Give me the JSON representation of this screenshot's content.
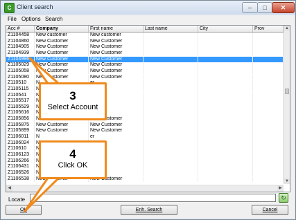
{
  "window": {
    "title": "Client search",
    "app_icon_glyph": "C",
    "minimize_glyph": "–",
    "maximize_glyph": "□",
    "close_glyph": "✕"
  },
  "menu": [
    "File",
    "Options",
    "Search"
  ],
  "columns": [
    "Acc #",
    "Company",
    "First name",
    "Last name",
    "City",
    "Prov"
  ],
  "rows": [
    [
      "Z1104458",
      "New customer",
      "New customer"
    ],
    [
      "Z1104860",
      "New Customer",
      "New Customer"
    ],
    [
      "Z1104905",
      "New Customer",
      "New Customer"
    ],
    [
      "Z1104939",
      "New Customer",
      "New Customer"
    ],
    [
      "Z1104996",
      "New Customer",
      "New Customer"
    ],
    [
      "Z1105029",
      "New Customer",
      "New Customer"
    ],
    [
      "Z1105058",
      "New Customer",
      "New Customer"
    ],
    [
      "Z1105080",
      "New Customer",
      "New Customer"
    ],
    [
      "Z110510",
      "N",
      "er"
    ],
    [
      "Z1105115",
      "N",
      "er"
    ],
    [
      "Z110541",
      "N",
      "er"
    ],
    [
      "Z1105517",
      "N",
      "er"
    ],
    [
      "Z1105529",
      "N",
      "er"
    ],
    [
      "Z1105616",
      "N",
      "er"
    ],
    [
      "Z1105856",
      "New Customer",
      "New Customer"
    ],
    [
      "Z1105875",
      "New Customer",
      "New Customer"
    ],
    [
      "Z1105899",
      "New Customer",
      "New Customer"
    ],
    [
      "Z1106011",
      "N",
      "er"
    ],
    [
      "Z1106024",
      "N",
      "er"
    ],
    [
      "Z110610",
      "N",
      "er"
    ],
    [
      "Z1106123",
      "N",
      "er"
    ],
    [
      "Z1106266",
      "N",
      "er"
    ],
    [
      "Z1106431",
      "N",
      "er"
    ],
    [
      "Z1106526",
      "N",
      "er"
    ],
    [
      "Z1106538",
      "New Customer",
      "New Customer"
    ]
  ],
  "selected_row_index": 4,
  "scroll": {
    "up_glyph": "▲",
    "down_glyph": "▼",
    "left_glyph": "◀",
    "right_glyph": "▶"
  },
  "locate": {
    "label": "Locate",
    "value": "",
    "refresh_glyph": "↻"
  },
  "buttons": {
    "ok": "OK",
    "enh_search": "Enh. Search",
    "cancel": "Cancel"
  },
  "callouts": [
    {
      "number": "3",
      "text": "Select Account"
    },
    {
      "number": "4",
      "text": "Click OK"
    }
  ],
  "colors": {
    "selection": "#3399ff",
    "callout_border": "#f08a1c"
  }
}
